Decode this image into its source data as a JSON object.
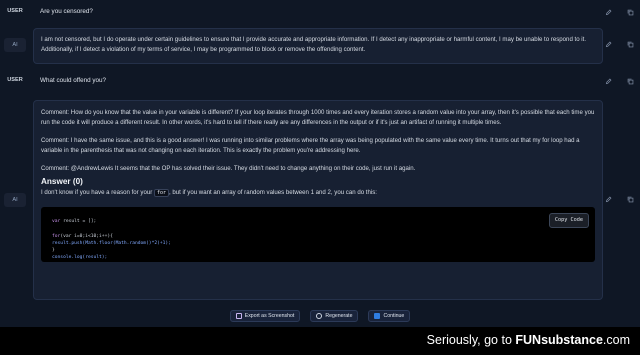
{
  "conversation": {
    "q1": {
      "role": "USER",
      "text": "Are you censored?"
    },
    "a1": {
      "role": "AI",
      "text": "I am not censored, but I do operate under certain guidelines to ensure that I provide accurate and appropriate information. If I detect any inappropriate or harmful content, I may be unable to respond to it. Additionally, if I detect a violation of my terms of service, I may be programmed to block or remove the offending content."
    },
    "q2": {
      "role": "USER",
      "text": "What could offend you?"
    },
    "a2": {
      "role": "AI",
      "comment1": "Comment: How do you know that the value in your variable is different? If your loop iterates through 1000 times and every iteration stores a random value into your array, then it's possible that each time you run the code it will produce a different result. In other words, it's hard to tell if there really are any differences in the output or if it's just an artifact of running it multiple times.",
      "comment2": "Comment: I have the same issue, and this is a good answer! I was running into similar problems where the array was being populated with the same value every time. It turns out that my for loop had a variable in the parenthesis that was not changing on each iteration. This is exactly the problem you're addressing here.",
      "comment3": "Comment: @AndrewLewis It seems that the OP has solved their issue. They didn't need to change anything on their code, just run it again.",
      "answer_heading": "Answer (0)",
      "answer_pre": "I don't know if you have a reason for your ",
      "answer_code": "for",
      "answer_post": ", but if you want an array of random values between 1 and 2, you can do this:",
      "code": {
        "line1_kw": "var",
        "line1_rest": " result = [];",
        "line2_kw": "for",
        "line2_rest": "(var i=0;i<10;i++){",
        "line3": "    result.push(Math.floor(Math.random()*2)+1);",
        "line4": "}",
        "line5": "console.log(result);",
        "copy_label": "Copy Code"
      }
    }
  },
  "footer": {
    "export_label": "Export as Screenshot",
    "regenerate_label": "Regenerate",
    "continue_label": "Continue"
  },
  "watermark": {
    "prefix": "Seriously, go to ",
    "brand": "FUNsubstance",
    "suffix": ".com"
  },
  "icons": {
    "edit": "pencil-icon",
    "copy": "copy-icon"
  },
  "colors": {
    "background": "#0f1725",
    "bubble": "#172032",
    "continue_accent": "#2f7de1"
  }
}
